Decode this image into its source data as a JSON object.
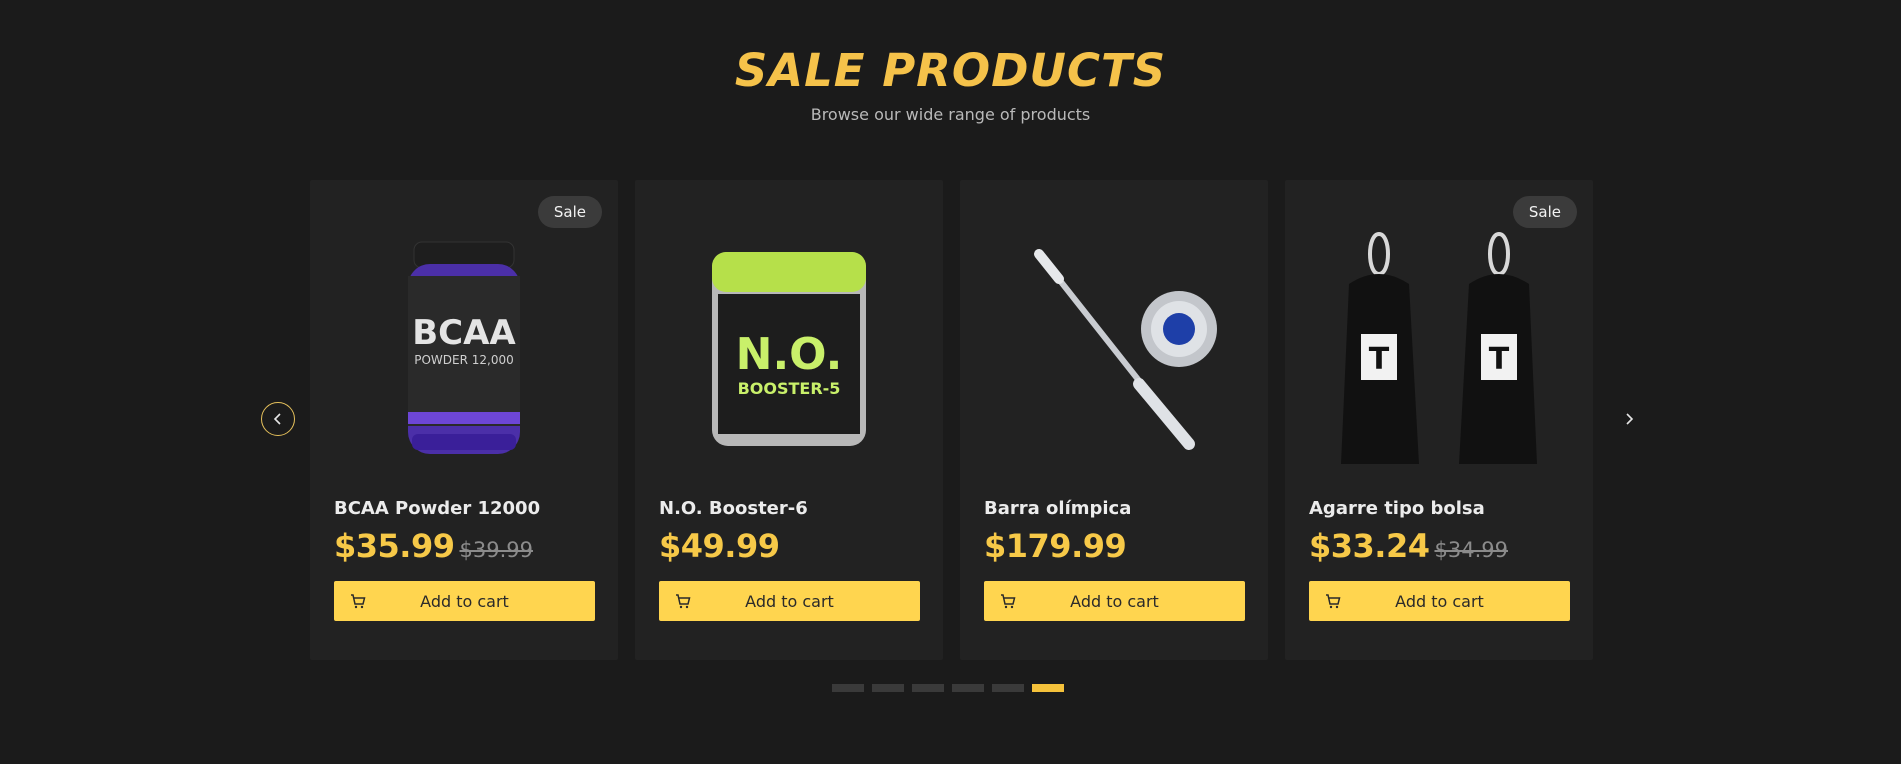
{
  "section": {
    "title": "SALE PRODUCTS",
    "subtitle": "Browse our wide range of products"
  },
  "colors": {
    "background": "#1b1b1b",
    "card": "#222222",
    "accent": "#f5c24a",
    "button": "#ffd54f",
    "badge": "#3b3b3b"
  },
  "carousel": {
    "prev_icon": "chevron-left-icon",
    "next_icon": "chevron-right-icon",
    "dot_count": 6,
    "active_dot": 6
  },
  "products": [
    {
      "name": "BCAA Powder 12000",
      "price": "$35.99",
      "old_price": "$39.99",
      "badge": "Sale",
      "button": "Add to cart",
      "image": "bcaa-tub-image"
    },
    {
      "name": "N.O. Booster-6",
      "price": "$49.99",
      "old_price": "",
      "badge": "",
      "button": "Add to cart",
      "image": "supplement-tub-image"
    },
    {
      "name": "Barra olímpica",
      "price": "$179.99",
      "old_price": "",
      "badge": "",
      "button": "Add to cart",
      "image": "barbell-image"
    },
    {
      "name": "Agarre tipo bolsa",
      "price": "$33.24",
      "old_price": "$34.99",
      "badge": "Sale",
      "button": "Add to cart",
      "image": "ab-straps-image"
    }
  ]
}
